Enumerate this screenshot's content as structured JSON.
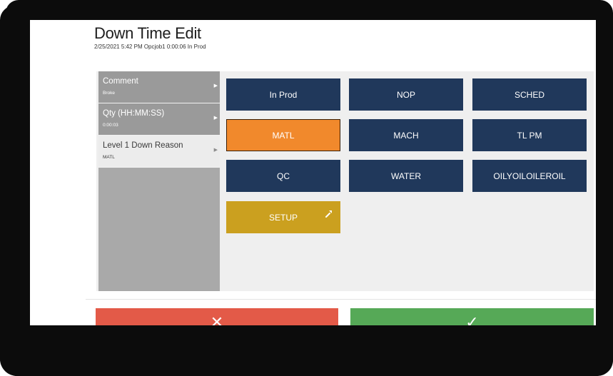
{
  "header": {
    "title": "Down Time Edit",
    "subtitle": "2/25/2021 5:42 PM Opcjob1 0:00:06 In Prod"
  },
  "sidebar": {
    "items": [
      {
        "label": "Comment",
        "value": "Broke"
      },
      {
        "label": "Qty (HH:MM:SS)",
        "value": "0:00:03"
      },
      {
        "label": "Level 1 Down Reason",
        "value": "MATL"
      }
    ]
  },
  "reasons": {
    "in_prod": "In Prod",
    "nop": "NOP",
    "sched": "SCHED",
    "matl": "MATL",
    "mach": "MACH",
    "tl_pm": "TL PM",
    "qc": "QC",
    "water": "WATER",
    "oily": "OILYOILOILEROIL",
    "setup": "SETUP"
  },
  "footer": {
    "cancel_icon": "✕",
    "confirm_icon": "✓"
  },
  "colors": {
    "navy": "#20385b",
    "selected_orange": "#f1892c",
    "setup_gold": "#cba01f",
    "cancel_red": "#e35a48",
    "confirm_green": "#56a957"
  },
  "icons": {
    "sidebar_arrow": "chevron-right-icon",
    "setup": "wrench-icon",
    "cancel": "close-icon",
    "confirm": "check-icon"
  }
}
